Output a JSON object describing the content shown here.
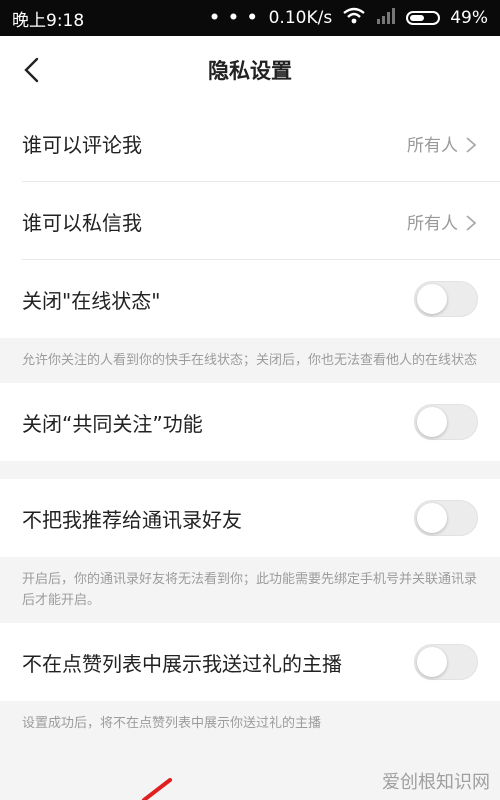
{
  "statusbar": {
    "time": "晚上9:18",
    "dots": "• • •",
    "speed": "0.10K/s",
    "battery": "49%"
  },
  "header": {
    "title": "隐私设置"
  },
  "settings": [
    {
      "label": "谁可以评论我",
      "value": "所有人"
    },
    {
      "label": "谁可以私信我",
      "value": "所有人"
    },
    {
      "label": "关闭\"在线状态\"",
      "desc": "允许你关注的人看到你的快手在线状态；关闭后，你也无法查看他人的在线状态"
    },
    {
      "label": "关闭“共同关注”功能"
    },
    {
      "label": "不把我推荐给通讯录好友",
      "desc": "开启后，你的通讯录好友将无法看到你；此功能需要先绑定手机号并关联通讯录后才能开启。"
    },
    {
      "label": "不在点赞列表中展示我送过礼的主播",
      "desc": "设置成功后，将不在点赞列表中展示你送过礼的主播"
    }
  ],
  "watermark": "爱创根知识网",
  "colors": {
    "statusbar_bg": "#0a0a0a",
    "toggle_off": "#ececec",
    "text": "#222222",
    "muted": "#9c9c9c"
  }
}
